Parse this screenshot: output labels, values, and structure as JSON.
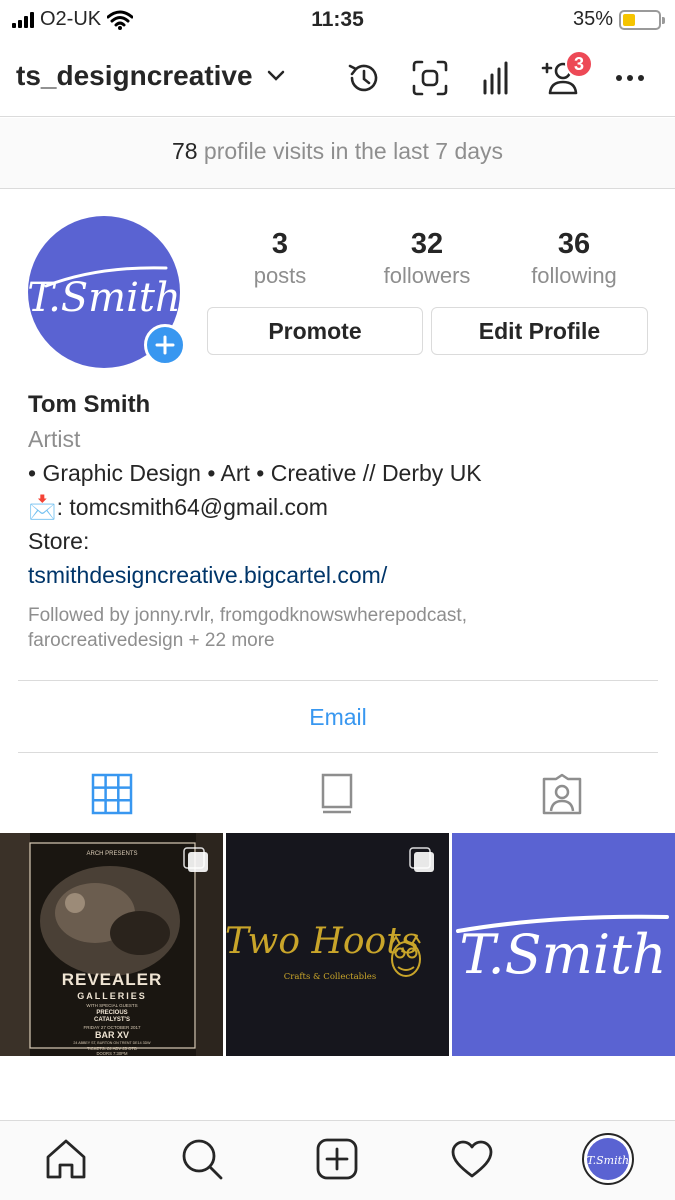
{
  "status_bar": {
    "carrier": "O2-UK",
    "time": "11:35",
    "battery_percent": "35%",
    "battery_level": 0.35,
    "battery_color": "#f5c400"
  },
  "header": {
    "username": "ts_designcreative",
    "icons": [
      "history-icon",
      "scan-icon",
      "insights-icon",
      "discover-people-icon",
      "more-icon"
    ],
    "notification_count": "3"
  },
  "visits": {
    "count": "78",
    "text": "profile visits in the last 7 days"
  },
  "profile": {
    "avatar_text": "T.Smith",
    "avatar_color": "#5a63d2",
    "stats": [
      {
        "value": "3",
        "label": "posts"
      },
      {
        "value": "32",
        "label": "followers"
      },
      {
        "value": "36",
        "label": "following"
      }
    ],
    "buttons": {
      "promote": "Promote",
      "edit": "Edit Profile"
    },
    "name": "Tom Smith",
    "category": "Artist",
    "bio_line": "• Graphic Design • Art • Creative // Derby UK",
    "email_emoji": "📩",
    "email_line": ": tomcsmith64@gmail.com",
    "store_label": "Store:",
    "store_link": "tsmithdesigncreative.bigcartel.com/",
    "followed_by_line1": "Followed by jonny.rvlr, fromgodknowswherepodcast,",
    "followed_by_line2": "farocreativedesign + 22 more"
  },
  "contact_button": "Email",
  "tabs": [
    "grid-icon",
    "guide-icon",
    "tagged-icon"
  ],
  "posts": [
    {
      "kind": "poster",
      "small_top": "ARCH PRESENTS",
      "title": "REVEALER",
      "subtitle": "GALLERIES",
      "with": "WITH SPECIAL GUESTS",
      "guest1": "PRECIOUS",
      "guest2": "CATALYST'S",
      "date": "FRIDAY 27 OCTOBER 2017",
      "venue": "BAR XV",
      "address": "24 ABBEY ST, BURTON ON TRENT DE14 3DW",
      "tickets": "TICKETS: £4 ADV  £5 OTD",
      "doors": "DOORS 7:30PM"
    },
    {
      "kind": "logo",
      "brand": "Two Hoots",
      "tagline": "Crafts & Collectables"
    },
    {
      "kind": "logo",
      "brand": "T.Smith"
    }
  ],
  "bottom_nav": [
    "home-icon",
    "search-icon",
    "new-post-icon",
    "activity-icon",
    "profile-avatar"
  ],
  "colors": {
    "link": "#003569",
    "accent": "#3897f0",
    "badge": "#ed4956",
    "muted": "#8e8e8e"
  }
}
